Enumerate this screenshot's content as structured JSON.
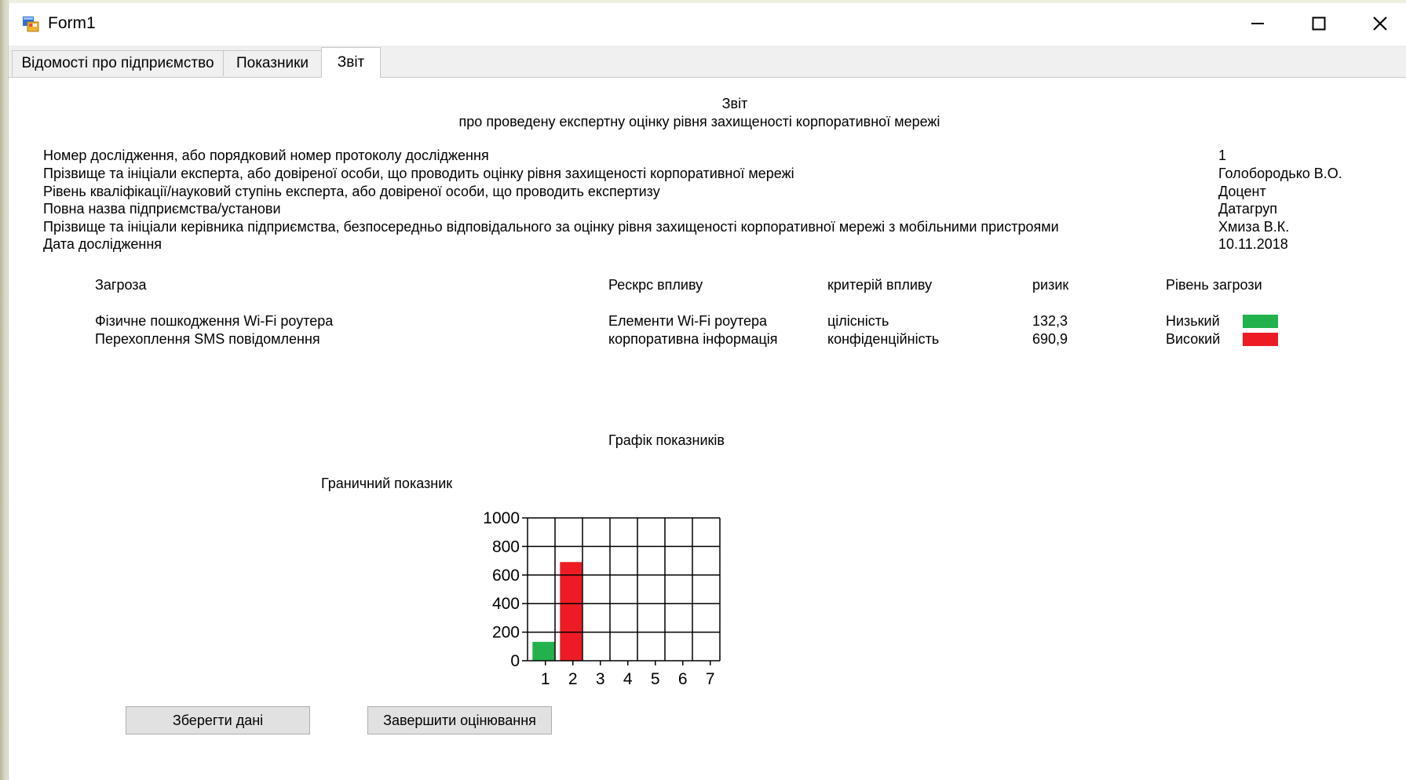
{
  "window": {
    "title": "Form1"
  },
  "tabs": [
    {
      "label": "Відомості про підприємство"
    },
    {
      "label": "Показники"
    },
    {
      "label": "Звіт"
    }
  ],
  "report": {
    "heading": "Звіт",
    "subheading": "про проведену експертну оцінку рівня захищеності корпоративної мережі",
    "info": [
      {
        "label": "Номер дослідження, або порядковий номер протоколу дослідження",
        "value": "1"
      },
      {
        "label": "Прізвище та ініціали експерта, або довіреної особи, що проводить оцінку рівня захищеності корпоративної мережі",
        "value": "Голобородько В.О."
      },
      {
        "label": "Рівень кваліфікації/науковий ступінь експерта, або довіреної особи, що проводить експертизу",
        "value": "Доцент"
      },
      {
        "label": "Повна назва підприємства/установи",
        "value": "Датагруп"
      },
      {
        "label": "Прізвище та ініціали керівника підприємства, безпосередньо відповідального за оцінку рівня захищеності корпоративної мережі з мобільними пристроями",
        "value": "Хмиза В.К."
      },
      {
        "label": "Дата дослідження",
        "value": "10.11.2018"
      }
    ],
    "table": {
      "headers": [
        "Загроза",
        "Рескрс впливу",
        "критерій впливу",
        "ризик",
        "Рівень загрози"
      ],
      "rows": [
        {
          "threat": "Фізичне пошкодження Wi-Fi роутера",
          "resource": "Елементи Wi-Fi роутера",
          "criterion": "цілісність",
          "risk": "132,3",
          "level": "Низький",
          "color": "#22b14c"
        },
        {
          "threat": "Перехоплення SMS повідомлення",
          "resource": "корпоративна інформація",
          "criterion": "конфіденційність",
          "risk": "690,9",
          "level": "Високий",
          "color": "#ed1c24"
        }
      ]
    }
  },
  "chart_section": {
    "title": "Графік показників",
    "threshold_label": "Граничний показник"
  },
  "chart_data": {
    "type": "bar",
    "categories": [
      "1",
      "2",
      "3",
      "4",
      "5",
      "6",
      "7"
    ],
    "values": [
      132.3,
      690.9,
      null,
      null,
      null,
      null,
      null
    ],
    "colors": [
      "#22b14c",
      "#ed1c24"
    ],
    "ylim": [
      0,
      1000
    ],
    "yticks": [
      0,
      200,
      400,
      600,
      800,
      1000
    ],
    "grid": true
  },
  "buttons": {
    "save": "Зберегти дані",
    "finish": "Завершити оцінювання"
  }
}
